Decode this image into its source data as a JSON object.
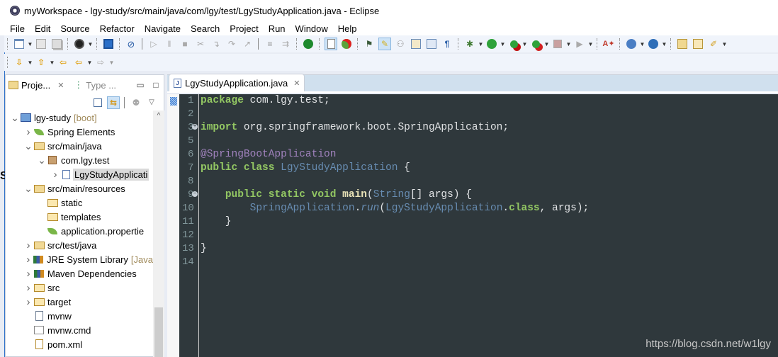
{
  "window": {
    "title": "myWorkspace - lgy-study/src/main/java/com/lgy/test/LgyStudyApplication.java - Eclipse"
  },
  "menu": [
    "File",
    "Edit",
    "Source",
    "Refactor",
    "Navigate",
    "Search",
    "Project",
    "Run",
    "Window",
    "Help"
  ],
  "toolbar": {
    "row1": [
      "new-wizard",
      "save",
      "save-all",
      "user-profile",
      "open-console",
      "skip-breakpoints",
      "resume",
      "suspend",
      "terminate",
      "disconnect",
      "step-into",
      "step-over",
      "step-return",
      "drop-to-frame",
      "use-step-filters",
      "spring-boot-dashboard",
      "toggle-word-wrap",
      "spring-problems",
      "open-type-hierarchy",
      "toggle-mark-occurrences",
      "block-selection",
      "next-annotation",
      "show-whitespace",
      "paragraph-marks",
      "debug",
      "run",
      "run-server",
      "profile",
      "stop",
      "external-tools",
      "new-java-class",
      "new-web-service",
      "spring-starter",
      "open-project",
      "open-folder",
      "search-tool"
    ],
    "row2": [
      "next-annotation",
      "previous-annotation",
      "last-edit-location",
      "back",
      "forward"
    ]
  },
  "project_explorer": {
    "tabs": [
      {
        "label": "Proje...",
        "active": true
      },
      {
        "label": "Type ...",
        "active": false
      }
    ],
    "tree": [
      {
        "label": "lgy-study",
        "decoration": "[boot]",
        "depth": 0,
        "expanded": true,
        "icon": "maven-spring-project-icon"
      },
      {
        "label": "Spring Elements",
        "depth": 1,
        "expanded": false,
        "icon": "spring-leaf-icon"
      },
      {
        "label": "src/main/java",
        "depth": 1,
        "expanded": true,
        "icon": "source-folder-icon"
      },
      {
        "label": "com.lgy.test",
        "depth": 2,
        "expanded": true,
        "icon": "package-icon"
      },
      {
        "label": "LgyStudyApplication.java",
        "display": "LgyStudyApplicati",
        "depth": 3,
        "expanded": false,
        "icon": "spring-java-file-icon",
        "selected": true
      },
      {
        "label": "src/main/resources",
        "depth": 1,
        "expanded": true,
        "icon": "source-folder-icon"
      },
      {
        "label": "static",
        "depth": 2,
        "icon": "folder-icon"
      },
      {
        "label": "templates",
        "depth": 2,
        "icon": "folder-icon"
      },
      {
        "label": "application.properties",
        "display": "application.propertie",
        "depth": 2,
        "icon": "spring-leaf-icon"
      },
      {
        "label": "src/test/java",
        "depth": 1,
        "expanded": false,
        "icon": "source-folder-icon"
      },
      {
        "label": "JRE System Library",
        "decoration": "[Java",
        "depth": 1,
        "expanded": false,
        "icon": "library-icon"
      },
      {
        "label": "Maven Dependencies",
        "depth": 1,
        "expanded": false,
        "icon": "library-icon"
      },
      {
        "label": "src",
        "depth": 1,
        "expanded": false,
        "icon": "folder-icon"
      },
      {
        "label": "target",
        "depth": 1,
        "expanded": false,
        "icon": "folder-icon"
      },
      {
        "label": "mvnw",
        "depth": 1,
        "icon": "text-file-icon"
      },
      {
        "label": "mvnw.cmd",
        "depth": 1,
        "icon": "cmd-file-icon"
      },
      {
        "label": "pom.xml",
        "depth": 1,
        "icon": "maven-pom-icon"
      }
    ]
  },
  "editor": {
    "tab": {
      "label": "LgyStudyApplication.java"
    },
    "lines": [
      {
        "n": "1",
        "tokens": [
          [
            "kw",
            "package"
          ],
          [
            "t",
            " com.lgy.test;"
          ]
        ]
      },
      {
        "n": "2",
        "tokens": []
      },
      {
        "n": "3",
        "fold": "plus",
        "tokens": [
          [
            "kw",
            "import"
          ],
          [
            "t",
            " org.springframework.boot.SpringApplication;"
          ]
        ]
      },
      {
        "n": "5",
        "tokens": []
      },
      {
        "n": "6",
        "tokens": [
          [
            "ann",
            "@SpringBootApplication"
          ]
        ]
      },
      {
        "n": "7",
        "tokens": [
          [
            "kw",
            "public"
          ],
          [
            "t",
            " "
          ],
          [
            "kw",
            "class"
          ],
          [
            "t",
            " "
          ],
          [
            "type",
            "LgyStudyApplication"
          ],
          [
            "t",
            " {"
          ]
        ]
      },
      {
        "n": "8",
        "tokens": []
      },
      {
        "n": "9",
        "fold": "minus",
        "tokens": [
          [
            "t",
            "    "
          ],
          [
            "kw",
            "public"
          ],
          [
            "t",
            " "
          ],
          [
            "kw",
            "static"
          ],
          [
            "t",
            " "
          ],
          [
            "kw",
            "void"
          ],
          [
            "t",
            " "
          ],
          [
            "meth",
            "main"
          ],
          [
            "t",
            "("
          ],
          [
            "type",
            "String"
          ],
          [
            "t",
            "[] args) {"
          ]
        ]
      },
      {
        "n": "10",
        "tokens": [
          [
            "t",
            "        "
          ],
          [
            "type",
            "SpringApplication"
          ],
          [
            "t",
            "."
          ],
          [
            "call",
            "run"
          ],
          [
            "t",
            "("
          ],
          [
            "type",
            "LgyStudyApplication"
          ],
          [
            "t",
            "."
          ],
          [
            "kw",
            "class"
          ],
          [
            "t",
            ", args);"
          ]
        ]
      },
      {
        "n": "11",
        "tokens": [
          [
            "t",
            "    }"
          ]
        ]
      },
      {
        "n": "12",
        "tokens": []
      },
      {
        "n": "13",
        "tokens": [
          [
            "t",
            "}"
          ]
        ]
      },
      {
        "n": "14",
        "tokens": []
      }
    ]
  },
  "watermark": "https://blog.csdn.net/w1lgy",
  "colors": {
    "editor_bg": "#2f383c",
    "keyword": "#93c763",
    "annotation": "#a082bd",
    "type": "#678cb1",
    "selection_accent": "#2b6fc8"
  }
}
